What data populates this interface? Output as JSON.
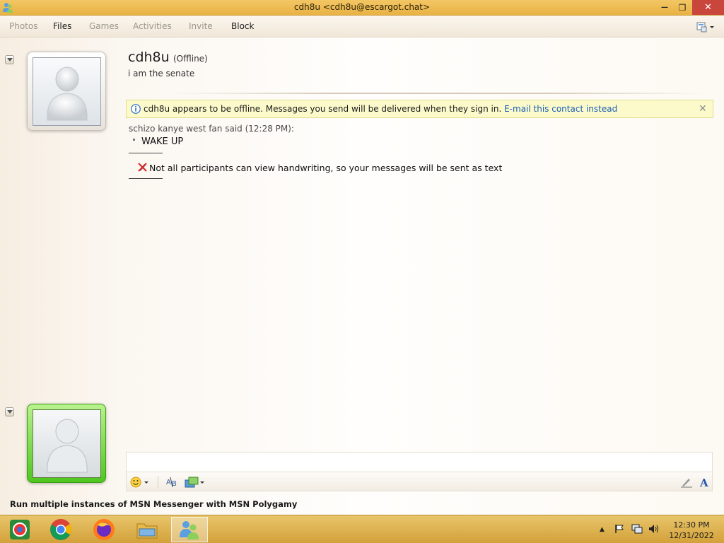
{
  "window": {
    "title": "cdh8u <cdh8u@escargot.chat>",
    "close_glyph": "✕",
    "minimize_glyph": "—",
    "maximize_glyph": "❐"
  },
  "menu": {
    "items": [
      {
        "label": "Photos",
        "enabled": false
      },
      {
        "label": "Files",
        "enabled": true
      },
      {
        "label": "Games",
        "enabled": false
      },
      {
        "label": "Activities",
        "enabled": false
      },
      {
        "label": "Invite",
        "enabled": false
      },
      {
        "label": "Block",
        "enabled": true
      }
    ],
    "options_icon": "layout-options-icon"
  },
  "contact": {
    "name": "cdh8u",
    "status": "(Offline)",
    "personal_message": "i am the senate"
  },
  "info_bar": {
    "message": "cdh8u appears to be offline. Messages you send will be delivered when they sign in.",
    "link": "E-mail this contact instead",
    "close_glyph": "✕"
  },
  "conversation": {
    "sender_line": "schizo kanye west fan said (12:28 PM):",
    "message": "WAKE UP",
    "notice": "Not all participants can view handwriting, so your messages will be sent as text"
  },
  "input": {
    "value": ""
  },
  "footer": {
    "ad_text": "Run multiple instances of MSN Messenger with MSN Polygamy"
  },
  "taskbar": {
    "apps": [
      "browser-app-icon",
      "chrome-icon",
      "firefox-icon",
      "file-explorer-icon",
      "messenger-icon"
    ],
    "time": "12:30 PM",
    "date": "12/31/2022"
  }
}
